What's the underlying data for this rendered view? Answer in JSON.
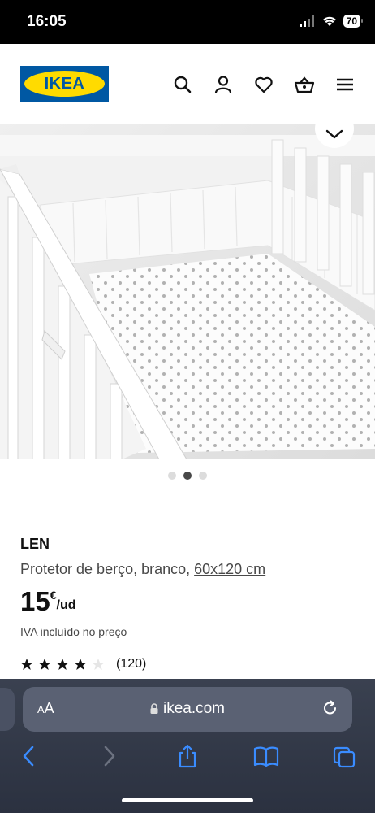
{
  "status_bar": {
    "time": "16:05",
    "battery": "70"
  },
  "header": {
    "logo_text": "IKEA",
    "icons": [
      "search-icon",
      "user-icon",
      "heart-icon",
      "basket-icon",
      "menu-icon"
    ]
  },
  "gallery": {
    "dots": 3,
    "active_index": 1
  },
  "product": {
    "name": "LEN",
    "description": "Protetor de berço, branco, ",
    "size": "60x120 cm",
    "price_integer": "15",
    "price_currency": "€",
    "price_unit": "/ud",
    "vat_note": "IVA incluído no preço",
    "rating_value": 4,
    "rating_max": 5,
    "rating_count": "(120)"
  },
  "safari": {
    "aa_label_small": "A",
    "aa_label_large": "A",
    "url": "ikea.com"
  },
  "colors": {
    "brand_blue": "#0058a3",
    "brand_yellow": "#ffdb00",
    "safari_accent": "#3a8cff"
  }
}
